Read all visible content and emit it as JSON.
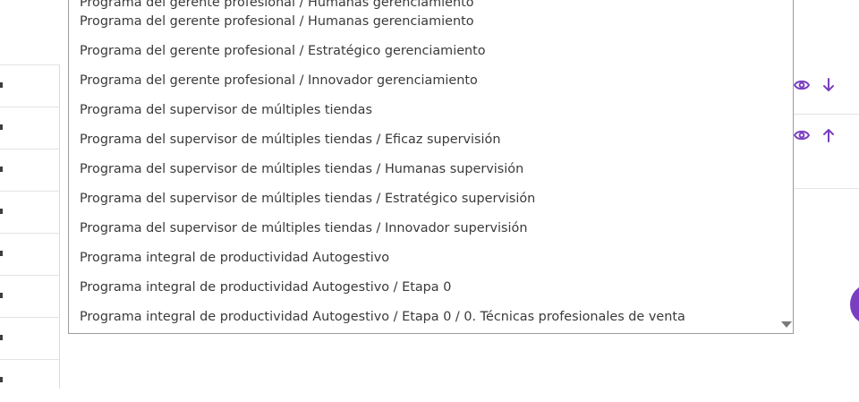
{
  "dropdown": {
    "options": [
      "Programa del gerente profesional / Humanas gerenciamiento",
      "Programa del gerente profesional / Humanas gerenciamiento",
      "Programa del gerente profesional / Estratégico gerenciamiento",
      "Programa del gerente profesional / Innovador gerenciamiento",
      "Programa del supervisor de múltiples tiendas",
      "Programa del supervisor de múltiples tiendas / Eficaz supervisión",
      "Programa del supervisor de múltiples tiendas / Humanas supervisión",
      "Programa del supervisor de múltiples tiendas / Estratégico supervisión",
      "Programa del supervisor de múltiples tiendas / Innovador supervisión",
      "Programa integral de productividad Autogestivo",
      "Programa integral de productividad Autogestivo / Etapa 0",
      "Programa integral de productividad Autogestivo / Etapa 0 / 0. Técnicas profesionales de venta"
    ]
  },
  "actions": [
    {
      "view_icon": "eye-icon",
      "move_icon": "arrow-down-icon"
    },
    {
      "view_icon": "eye-icon",
      "move_icon": "arrow-up-icon"
    }
  ],
  "colors": {
    "accent": "#7a3fc1",
    "text": "#3a3a3a",
    "border": "#9a9a9a"
  }
}
